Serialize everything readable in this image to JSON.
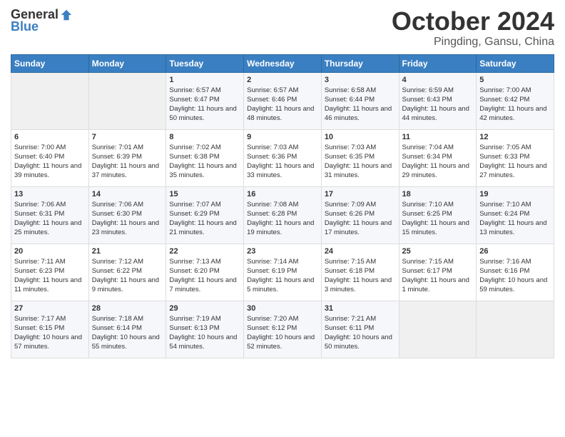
{
  "header": {
    "logo_general": "General",
    "logo_blue": "Blue",
    "month": "October 2024",
    "location": "Pingding, Gansu, China"
  },
  "days_of_week": [
    "Sunday",
    "Monday",
    "Tuesday",
    "Wednesday",
    "Thursday",
    "Friday",
    "Saturday"
  ],
  "weeks": [
    [
      {
        "day": "",
        "info": ""
      },
      {
        "day": "",
        "info": ""
      },
      {
        "day": "1",
        "info": "Sunrise: 6:57 AM\nSunset: 6:47 PM\nDaylight: 11 hours and 50 minutes."
      },
      {
        "day": "2",
        "info": "Sunrise: 6:57 AM\nSunset: 6:46 PM\nDaylight: 11 hours and 48 minutes."
      },
      {
        "day": "3",
        "info": "Sunrise: 6:58 AM\nSunset: 6:44 PM\nDaylight: 11 hours and 46 minutes."
      },
      {
        "day": "4",
        "info": "Sunrise: 6:59 AM\nSunset: 6:43 PM\nDaylight: 11 hours and 44 minutes."
      },
      {
        "day": "5",
        "info": "Sunrise: 7:00 AM\nSunset: 6:42 PM\nDaylight: 11 hours and 42 minutes."
      }
    ],
    [
      {
        "day": "6",
        "info": "Sunrise: 7:00 AM\nSunset: 6:40 PM\nDaylight: 11 hours and 39 minutes."
      },
      {
        "day": "7",
        "info": "Sunrise: 7:01 AM\nSunset: 6:39 PM\nDaylight: 11 hours and 37 minutes."
      },
      {
        "day": "8",
        "info": "Sunrise: 7:02 AM\nSunset: 6:38 PM\nDaylight: 11 hours and 35 minutes."
      },
      {
        "day": "9",
        "info": "Sunrise: 7:03 AM\nSunset: 6:36 PM\nDaylight: 11 hours and 33 minutes."
      },
      {
        "day": "10",
        "info": "Sunrise: 7:03 AM\nSunset: 6:35 PM\nDaylight: 11 hours and 31 minutes."
      },
      {
        "day": "11",
        "info": "Sunrise: 7:04 AM\nSunset: 6:34 PM\nDaylight: 11 hours and 29 minutes."
      },
      {
        "day": "12",
        "info": "Sunrise: 7:05 AM\nSunset: 6:33 PM\nDaylight: 11 hours and 27 minutes."
      }
    ],
    [
      {
        "day": "13",
        "info": "Sunrise: 7:06 AM\nSunset: 6:31 PM\nDaylight: 11 hours and 25 minutes."
      },
      {
        "day": "14",
        "info": "Sunrise: 7:06 AM\nSunset: 6:30 PM\nDaylight: 11 hours and 23 minutes."
      },
      {
        "day": "15",
        "info": "Sunrise: 7:07 AM\nSunset: 6:29 PM\nDaylight: 11 hours and 21 minutes."
      },
      {
        "day": "16",
        "info": "Sunrise: 7:08 AM\nSunset: 6:28 PM\nDaylight: 11 hours and 19 minutes."
      },
      {
        "day": "17",
        "info": "Sunrise: 7:09 AM\nSunset: 6:26 PM\nDaylight: 11 hours and 17 minutes."
      },
      {
        "day": "18",
        "info": "Sunrise: 7:10 AM\nSunset: 6:25 PM\nDaylight: 11 hours and 15 minutes."
      },
      {
        "day": "19",
        "info": "Sunrise: 7:10 AM\nSunset: 6:24 PM\nDaylight: 11 hours and 13 minutes."
      }
    ],
    [
      {
        "day": "20",
        "info": "Sunrise: 7:11 AM\nSunset: 6:23 PM\nDaylight: 11 hours and 11 minutes."
      },
      {
        "day": "21",
        "info": "Sunrise: 7:12 AM\nSunset: 6:22 PM\nDaylight: 11 hours and 9 minutes."
      },
      {
        "day": "22",
        "info": "Sunrise: 7:13 AM\nSunset: 6:20 PM\nDaylight: 11 hours and 7 minutes."
      },
      {
        "day": "23",
        "info": "Sunrise: 7:14 AM\nSunset: 6:19 PM\nDaylight: 11 hours and 5 minutes."
      },
      {
        "day": "24",
        "info": "Sunrise: 7:15 AM\nSunset: 6:18 PM\nDaylight: 11 hours and 3 minutes."
      },
      {
        "day": "25",
        "info": "Sunrise: 7:15 AM\nSunset: 6:17 PM\nDaylight: 11 hours and 1 minute."
      },
      {
        "day": "26",
        "info": "Sunrise: 7:16 AM\nSunset: 6:16 PM\nDaylight: 10 hours and 59 minutes."
      }
    ],
    [
      {
        "day": "27",
        "info": "Sunrise: 7:17 AM\nSunset: 6:15 PM\nDaylight: 10 hours and 57 minutes."
      },
      {
        "day": "28",
        "info": "Sunrise: 7:18 AM\nSunset: 6:14 PM\nDaylight: 10 hours and 55 minutes."
      },
      {
        "day": "29",
        "info": "Sunrise: 7:19 AM\nSunset: 6:13 PM\nDaylight: 10 hours and 54 minutes."
      },
      {
        "day": "30",
        "info": "Sunrise: 7:20 AM\nSunset: 6:12 PM\nDaylight: 10 hours and 52 minutes."
      },
      {
        "day": "31",
        "info": "Sunrise: 7:21 AM\nSunset: 6:11 PM\nDaylight: 10 hours and 50 minutes."
      },
      {
        "day": "",
        "info": ""
      },
      {
        "day": "",
        "info": ""
      }
    ]
  ]
}
